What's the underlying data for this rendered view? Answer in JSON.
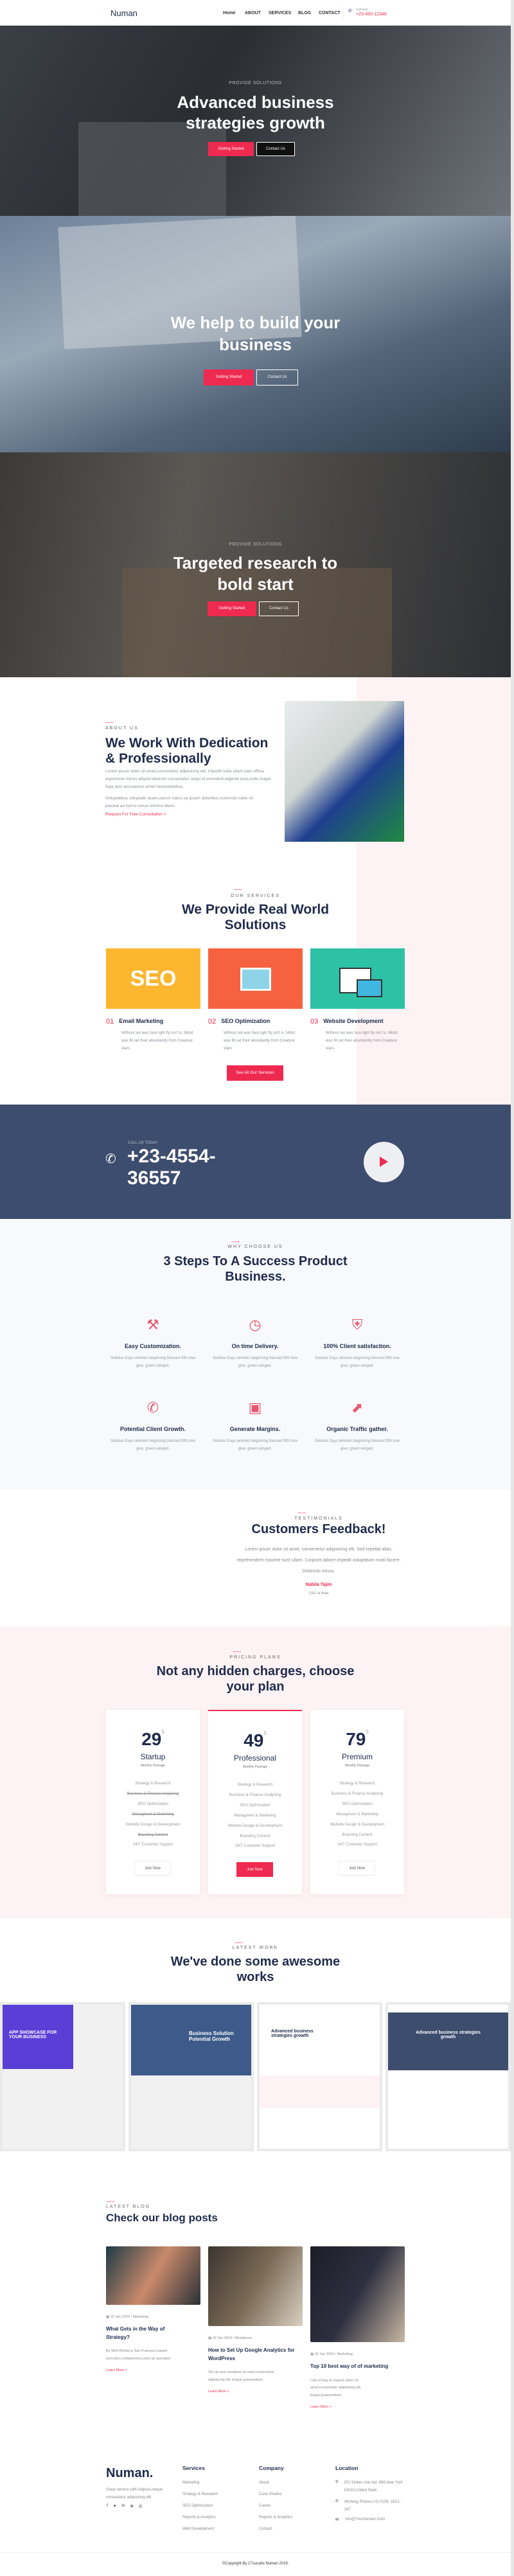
{
  "header": {
    "logo": "Numan",
    "nav": [
      "Home",
      "ABOUT",
      "SERVICES",
      "BLOG",
      "CONTACT"
    ],
    "call_label": "Call Now:",
    "phone": "+23-450-12346"
  },
  "heroes": [
    {
      "subtitle": "PROVIDE SOLUTIONS",
      "title_lines": [
        "Advanced business",
        "strategies growth"
      ],
      "primary": "Getting Started",
      "secondary": "Contact Us"
    },
    {
      "subtitle": "PROVIDE SOLUTIONS",
      "title_lines": [
        "We help to build your",
        "business"
      ],
      "primary": "Getting Started",
      "secondary": "Contact Us"
    },
    {
      "subtitle": "PROVIDE SOLUTIONS",
      "title_lines": [
        "Targeted research to",
        "bold start"
      ],
      "primary": "Getting Started",
      "secondary": "Contact Us"
    }
  ],
  "about": {
    "label": "ABOUT US",
    "title_lines": [
      "We Work With Dedication",
      "& Professionally"
    ],
    "para1": "Lorem ipsum dolor sit amet,consectetur adipisicing elit. Impedit nulla ullam nam officia asperiores minus aliquid laborum consectetur sequi et provident,eligendi ipsa,unde magni fuga quis accusamus amet necessitatibus.",
    "para2": "Voluptatibus voluptate quam,earum natus ea ipsam doloribus,commodi nobis sit placeat ad nemo minus minima libero.",
    "link": "Request For Free Consultation >"
  },
  "services": {
    "label": "OUR SERVICES",
    "title_lines": [
      "We Provide Real World",
      "Solutions"
    ],
    "items": [
      {
        "num": "01",
        "title": "Email Marketing",
        "text": "Without set was face light fly isn't is. Midst was fill set their abundantly from Creature stars",
        "color": "#fdb62f",
        "image": "SEO"
      },
      {
        "num": "02",
        "title": "SEO Optimization",
        "text": "Without set was face light fly isn't is. Midst was fill set their abundantly from Creature stars",
        "color": "#f6623f",
        "image": "megaphone"
      },
      {
        "num": "03",
        "title": "Website Development",
        "text": "Without set was face light fly isn't is. Midst was fill set their abundantly from Creature stars",
        "color": "#2dc1a5",
        "image": "devices"
      }
    ],
    "button": "See All Our Services"
  },
  "call": {
    "label": "CALL US TODAY",
    "number_lines": [
      "+23-4554-",
      "36557"
    ]
  },
  "steps": {
    "label": "WHY CHOOSE US",
    "title_lines": [
      "3 Steps To A Success Product",
      "Business."
    ],
    "items": [
      {
        "icon": "tools-icon",
        "glyph": "⚒",
        "title": "Easy Customization.",
        "text": "Subdue Days wherein beginning blessed fifth tree give, green winged."
      },
      {
        "icon": "clock-icon",
        "glyph": "◷",
        "title": "On time Delivery.",
        "text": "Subdue Days wherein beginning blessed fifth tree give, green winged."
      },
      {
        "icon": "shield-icon",
        "glyph": "⛨",
        "title": "100% Client satisfaction.",
        "text": "Subdue Days wherein beginning blessed fifth tree give, green winged."
      },
      {
        "icon": "phone-24-7-icon",
        "glyph": "✆",
        "title": "Potential Client Growth.",
        "text": "Subdue Days wherein beginning blessed fifth tree give, green winged."
      },
      {
        "icon": "wallet-icon",
        "glyph": "▣",
        "title": "Generate Margins.",
        "text": "Subdue Days wherein beginning blessed fifth tree give, green winged."
      },
      {
        "icon": "chart-growth-icon",
        "glyph": "⬈",
        "title": "Organic Traffic gather.",
        "text": "Subdue Days wherein beginning blessed fifth tree give, green winged."
      }
    ]
  },
  "testimonial": {
    "label": "TESTIMONIALS",
    "title": "Customers Feedback!",
    "quote": "Lorem ipsum dolor sit amet, consectetur adipisicing elit. Sed repellat alias, reprehenderit maxime sunt ullam. Corporis labore impedit voluptatum modi facere. Distinctio minus.",
    "name": "Nabila Tajim",
    "role": "CEO of Bata"
  },
  "pricing": {
    "label": "PRICING PLANS",
    "title_lines": [
      "Not any hidden charges, choose",
      "your plan"
    ],
    "currency": "$",
    "plans": [
      {
        "price": "29",
        "name": "Startup",
        "period": "Monthly Package",
        "features": [
          {
            "t": "Strategy & Research",
            "on": true
          },
          {
            "t": "Business & Finance Analysing",
            "on": false
          },
          {
            "t": "SEO Optimization",
            "on": true
          },
          {
            "t": "Managment & Marketing",
            "on": false
          },
          {
            "t": "Website Design & Development",
            "on": true
          },
          {
            "t": "Branding Content",
            "on": false
          },
          {
            "t": "24/7 Customer Support",
            "on": true
          }
        ],
        "button": "Join Now",
        "featured": false
      },
      {
        "price": "49",
        "name": "Professional",
        "period": "Monthly Package",
        "features": [
          {
            "t": "Strategy & Research",
            "on": true
          },
          {
            "t": "Business & Finance Analysing",
            "on": true
          },
          {
            "t": "SEO Optimization",
            "on": true
          },
          {
            "t": "Managment & Marketing",
            "on": true
          },
          {
            "t": "Website Design & Development",
            "on": true
          },
          {
            "t": "Branding Content",
            "on": true
          },
          {
            "t": "24/7 Customer Support",
            "on": true
          }
        ],
        "button": "Join Now",
        "featured": true
      },
      {
        "price": "79",
        "name": "Premium",
        "period": "Monthly Package",
        "features": [
          {
            "t": "Strategy & Research",
            "on": true
          },
          {
            "t": "Business & Finance Analysing",
            "on": true
          },
          {
            "t": "SEO Optimization",
            "on": true
          },
          {
            "t": "Managment & Marketing",
            "on": true
          },
          {
            "t": "Website Design & Development",
            "on": true
          },
          {
            "t": "Branding Content",
            "on": true
          },
          {
            "t": "24/7 Customer Support",
            "on": true
          }
        ],
        "button": "Join Now",
        "featured": false
      }
    ]
  },
  "portfolio": {
    "label": "LATEST WORK",
    "title_lines": [
      "We've done some awesome",
      "works"
    ],
    "items": [
      {
        "heading": "APP SHOWCASE FOR YOUR BUSINESS",
        "color": "#5a3fd6"
      },
      {
        "heading": "Business Solution Potential Growth",
        "color": "#3d5a8a"
      },
      {
        "heading": "Advanced business strategies growth",
        "color": "#ffffff"
      },
      {
        "heading": "Advanced business strategies growth",
        "color": "#3d4d6e"
      }
    ]
  },
  "blog": {
    "label": "LATEST BLOG",
    "title": "Check our blog posts",
    "posts": [
      {
        "date": "02 Jan 2019",
        "category": "/ Marketing",
        "title": "What Gets in the Way of Strategy?",
        "text": "By Wolf Richter,a San Francisco based executive,entrepreneur,start up specialist",
        "link": "Learn More >"
      },
      {
        "date": "02 Jan 2019",
        "category": "/ Wordpress",
        "title": "How to Set Up Google Analytics for WordPress",
        "text": "Set up your wordprss sit amet,consectetur adipisicing elit. Eaque,praesentium.",
        "link": "Learn More >"
      },
      {
        "date": "02 Jan 2019",
        "category": "/ Marketing",
        "title": "Top 10 best way of of marketing",
        "text": "Lots of way to organic dolor sit amet,consectetur adipisicing elit. Eaque,praesentium.",
        "link": "Learn More >"
      }
    ]
  },
  "footer": {
    "logo": "Numan.",
    "about": "Great service with Adipisci,neque consectetur adipisicing elit.",
    "social": [
      "facebook-icon",
      "twitter-icon",
      "linkedin-icon",
      "pinterest-icon",
      "instagram-icon"
    ],
    "services_title": "Services",
    "services": [
      "Marketing",
      "Strategy & Research",
      "SEO Optimization",
      "Reports & Analytics",
      "Web Development"
    ],
    "company_title": "Company",
    "company": [
      "About",
      "Case Studies",
      "Career",
      "Reports & Analytics",
      "Contact"
    ],
    "location_title": "Location",
    "address": "201 Stokes Isle Apt. 896,New York 10010,United State",
    "phone": "Working Phone:(+2) 0109 -1812-347",
    "email": "Info@Yourdomain.Com",
    "copyright": "©Copyright By 17sucaito Numan 2019."
  },
  "colors": {
    "accent": "#ee2a50",
    "navy": "#1f2b4c",
    "call_bg": "#3d4d6e",
    "pink_bg": "#fdf2f4",
    "steps_bg": "#f8f9fc"
  }
}
